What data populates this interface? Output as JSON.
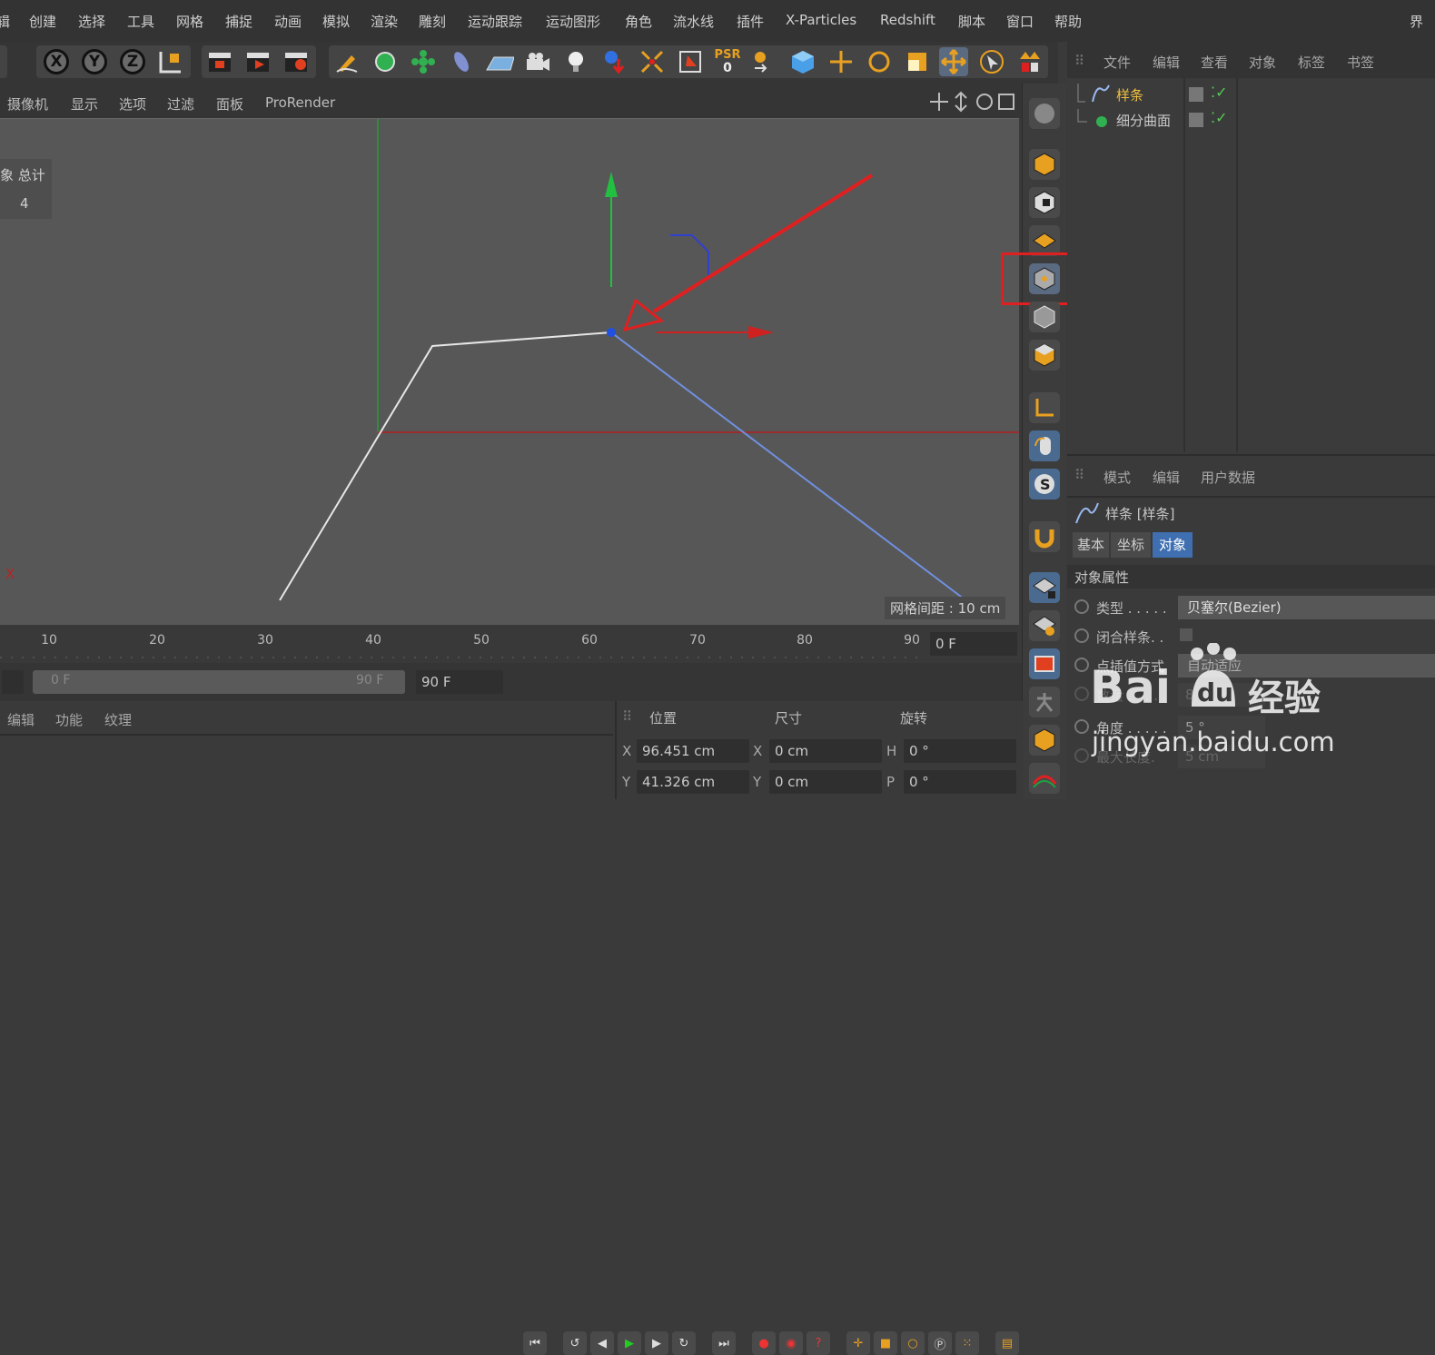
{
  "menubar": {
    "items": [
      "辑",
      "创建",
      "选择",
      "工具",
      "网格",
      "捕捉",
      "动画",
      "模拟",
      "渲染",
      "雕刻",
      "运动跟踪",
      "运动图形",
      "角色",
      "流水线",
      "插件",
      "X-Particles",
      "Redshift",
      "脚本",
      "窗口",
      "帮助"
    ],
    "right_text": "界"
  },
  "toolbar": {
    "axis_buttons": [
      "X",
      "Y",
      "Z"
    ],
    "psr_label": "PSR",
    "psr_value": "0"
  },
  "viewport_menu": [
    "摄像机",
    "显示",
    "选项",
    "过滤",
    "面板",
    "ProRender"
  ],
  "viewport": {
    "stats_label": "象 总计",
    "stats_value": "4",
    "grid_spacing": "网格间距 : 10 cm",
    "axis_marker": "X"
  },
  "object_manager": {
    "menu": [
      "文件",
      "编辑",
      "查看",
      "对象",
      "标签",
      "书签"
    ],
    "objects": [
      {
        "name": "样条",
        "color": "#f0c040"
      },
      {
        "name": "细分曲面",
        "color": "#c8c8c8"
      }
    ]
  },
  "attributes": {
    "menu": [
      "模式",
      "编辑",
      "用户数据"
    ],
    "object_title": "样条 [样条]",
    "tabs": [
      "基本",
      "坐标",
      "对象"
    ],
    "active_tab": "对象",
    "section": "对象属性",
    "rows": [
      {
        "label": "类型 . . . . .",
        "value": "贝塞尔(Bezier)"
      },
      {
        "label": "闭合样条. .",
        "value": ""
      },
      {
        "label": "点插值方式",
        "value": "自动适应"
      },
      {
        "label": "数量 . . . . .",
        "value": "8"
      },
      {
        "label": "角度 . . . . .",
        "value": "5 °"
      },
      {
        "label": "最大长度.",
        "value": "5 cm"
      }
    ]
  },
  "watermark": {
    "brand": "Bai",
    "brand2": "du",
    "suffix": "经验",
    "url": "jingyan.baidu.com"
  },
  "timeline": {
    "ticks": [
      "10",
      "20",
      "30",
      "40",
      "50",
      "60",
      "70",
      "80",
      "90"
    ],
    "current_frame": "0 F"
  },
  "playbar": {
    "start": "0 F",
    "end": "90 F",
    "end_field": "90 F"
  },
  "bottom_left_menu": [
    "编辑",
    "功能",
    "纹理"
  ],
  "coordinates": {
    "headers": [
      "位置",
      "尺寸",
      "旋转"
    ],
    "rows": [
      {
        "axis": "X",
        "pos": "96.451 cm",
        "size_axis": "X",
        "size": "0 cm",
        "rot_axis": "H",
        "rot": "0 °"
      },
      {
        "axis": "Y",
        "pos": "41.326 cm",
        "size_axis": "Y",
        "size": "0 cm",
        "rot_axis": "P",
        "rot": "0 °"
      }
    ]
  },
  "colors": {
    "accent_red": "#e02020",
    "spline_white": "#e6e6e6",
    "spline_blue": "#7090e0",
    "axis_green": "#22c040",
    "tab_active": "#3f6fb0"
  }
}
